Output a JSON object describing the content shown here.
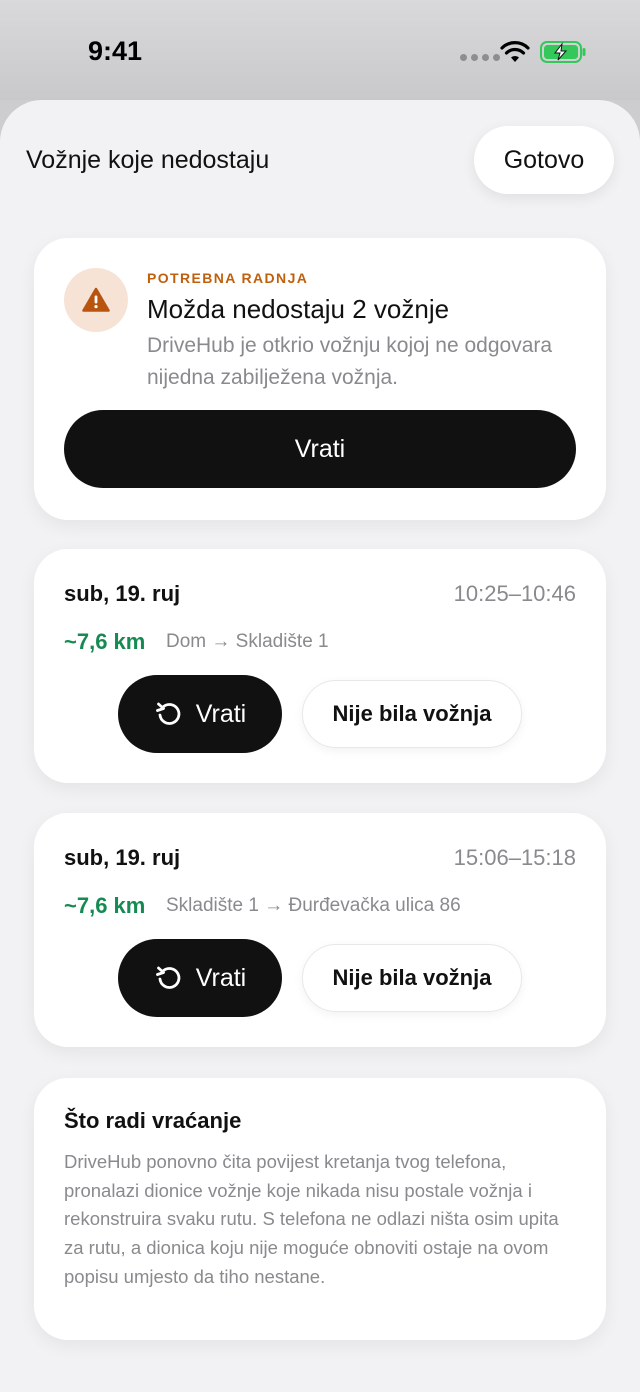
{
  "status_bar": {
    "time": "9:41"
  },
  "sheet": {
    "title": "Vožnje koje nedostaju",
    "done_label": "Gotovo"
  },
  "alert": {
    "kicker": "POTREBNA RADNJA",
    "title": "Možda nedostaju 2 vožnje",
    "description": "DriveHub je otkrio vožnju kojoj ne odgovara nijedna zabilježena vožnja.",
    "button_label": "Vrati"
  },
  "trips": [
    {
      "date": "sub, 19. ruj",
      "time_range": "10:25–10:46",
      "distance": "~7,6 km",
      "route": "Dom → Skladište 1",
      "restore_label": "Vrati",
      "not_trip_label": "Nije bila vožnja"
    },
    {
      "date": "sub, 19. ruj",
      "time_range": "15:06–15:18",
      "distance": "~7,6 km",
      "route": "Skladište 1 → Đurđevačka ulica 86",
      "restore_label": "Vrati",
      "not_trip_label": "Nije bila vožnja"
    }
  ],
  "info": {
    "title": "Što radi vraćanje",
    "body": "DriveHub ponovno čita povijest kretanja tvog telefona, pronalazi dionice vožnje koje nikada nisu postale vožnja i rekonstruira svaku rutu. S telefona ne odlazi ništa osim upita za rutu, a dionica koju nije moguće obnoviti ostaje na ovom popisu umjesto da tiho nestane."
  },
  "colors": {
    "warning": "#c0600c",
    "distance": "#168a52",
    "primary_button": "#111111",
    "battery": "#34c759"
  },
  "icons": [
    "wifi-icon",
    "battery-charging-icon",
    "warning-icon",
    "restore-icon"
  ]
}
